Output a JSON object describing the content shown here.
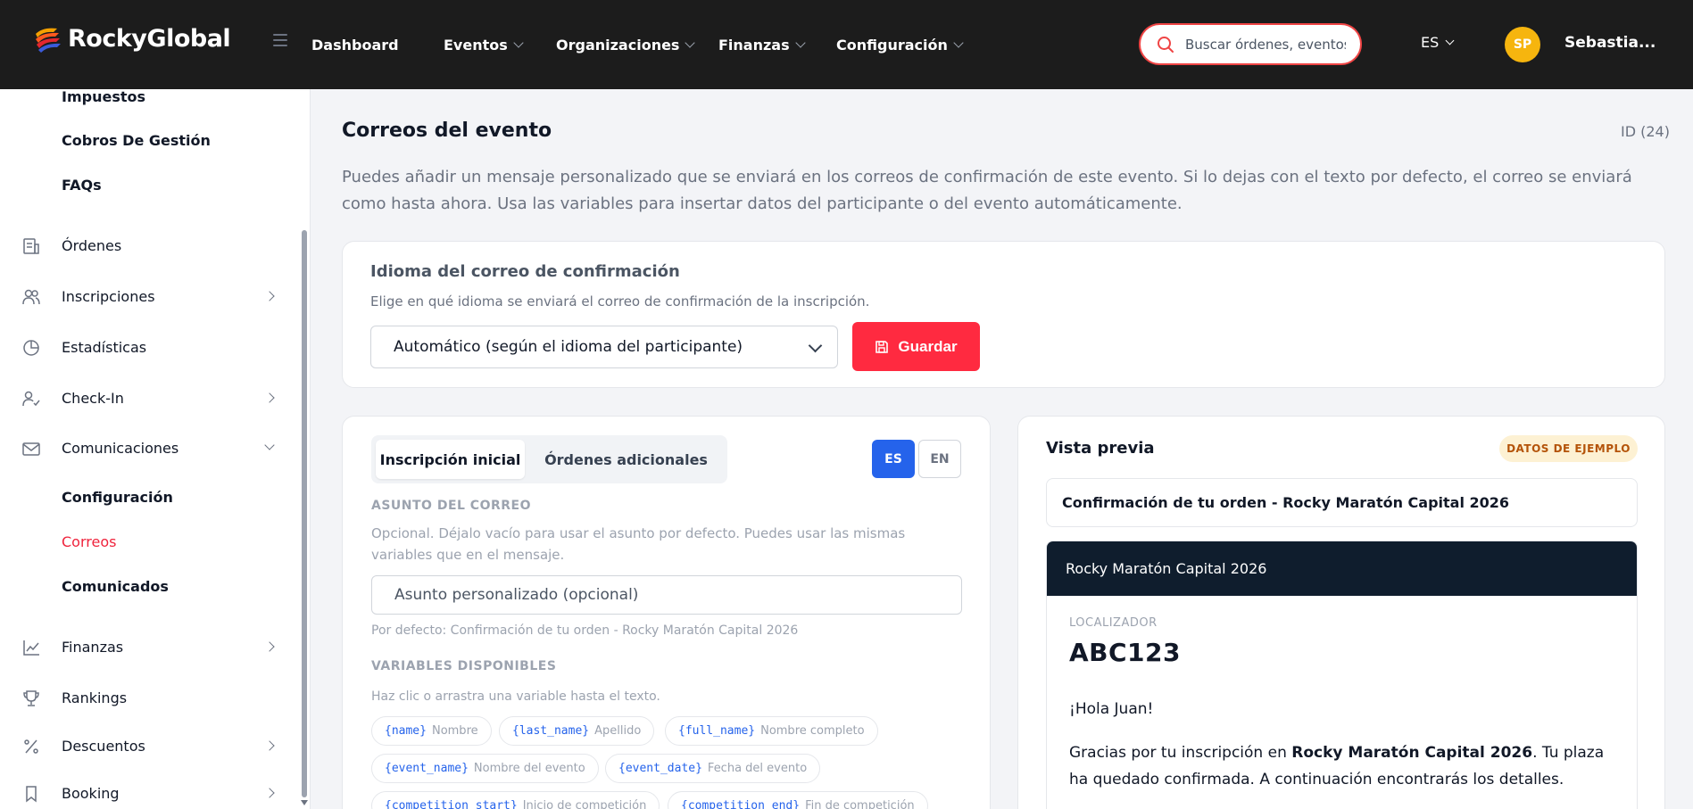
{
  "brand": {
    "name": "RockyGlobal"
  },
  "nav": [
    {
      "label": "Dashboard",
      "has_dropdown": false
    },
    {
      "label": "Eventos",
      "has_dropdown": true
    },
    {
      "label": "Organizaciones",
      "has_dropdown": true
    },
    {
      "label": "Finanzas",
      "has_dropdown": true
    },
    {
      "label": "Configuración",
      "has_dropdown": true
    }
  ],
  "search": {
    "placeholder": "Buscar órdenes, eventos"
  },
  "language": "ES",
  "user": {
    "initials": "SP",
    "name": "Sebastia..."
  },
  "sidebar": {
    "sub_top": [
      "Impuestos",
      "Cobros De Gestión",
      "FAQs"
    ],
    "items": [
      {
        "label": "Órdenes",
        "icon": "receipt-icon"
      },
      {
        "label": "Inscripciones",
        "icon": "users-icon"
      },
      {
        "label": "Estadísticas",
        "icon": "pie-chart-icon"
      },
      {
        "label": "Check-In",
        "icon": "user-check-icon"
      },
      {
        "label": "Comunicaciones",
        "icon": "mail-icon"
      }
    ],
    "comms_sub": [
      "Configuración",
      "Correos",
      "Comunicados"
    ],
    "items2": [
      {
        "label": "Finanzas",
        "icon": "trend-chart-icon"
      },
      {
        "label": "Rankings",
        "icon": "trophy-icon"
      },
      {
        "label": "Descuentos",
        "icon": "percent-icon"
      },
      {
        "label": "Booking",
        "icon": "bookmark-icon"
      }
    ]
  },
  "page": {
    "title": "Correos del evento",
    "id": "ID (24)",
    "description": "Puedes añadir un mensaje personalizado que se enviará en los correos de confirmación de este evento. Si lo dejas con el texto por defecto, el correo se enviará como hasta ahora. Usa las variables para insertar datos del participante o del evento automáticamente."
  },
  "language_card": {
    "title": "Idioma del correo de confirmación",
    "description": "Elige en qué idioma se enviará el correo de confirmación de la inscripción.",
    "selected": "Automático (según el idioma del participante)",
    "save_label": "Guardar"
  },
  "editor": {
    "tabs": [
      "Inscripción inicial",
      "Órdenes adicionales"
    ],
    "lang_buttons": [
      "ES",
      "EN"
    ],
    "subject_label": "ASUNTO DEL CORREO",
    "subject_help": "Opcional. Déjalo vacío para usar el asunto por defecto. Puedes usar las mismas variables que en el mensaje.",
    "subject_placeholder": "Asunto personalizado (opcional)",
    "subject_default": "Por defecto: Confirmación de tu orden - Rocky Maratón Capital 2026",
    "variables_label": "VARIABLES DISPONIBLES",
    "variables_help": "Haz clic o arrastra una variable hasta el texto.",
    "variables": [
      {
        "code": "{name}",
        "desc": "Nombre"
      },
      {
        "code": "{last_name}",
        "desc": "Apellido"
      },
      {
        "code": "{full_name}",
        "desc": "Nombre completo"
      },
      {
        "code": "{event_name}",
        "desc": "Nombre del evento"
      },
      {
        "code": "{event_date}",
        "desc": "Fecha del evento"
      },
      {
        "code": "{competition_start}",
        "desc": "Inicio de competición"
      },
      {
        "code": "{competition_end}",
        "desc": "Fin de competición"
      }
    ]
  },
  "preview": {
    "title": "Vista previa",
    "badge": "DATOS DE EJEMPLO",
    "subject": "Confirmación de tu orden - Rocky Maratón Capital 2026",
    "email_header": "Rocky Maratón Capital 2026",
    "locator_label": "LOCALIZADOR",
    "locator": "ABC123",
    "greeting": "¡Hola Juan!",
    "body_pre": "Gracias por tu inscripción en ",
    "body_event": "Rocky Maratón Capital 2026",
    "body_post": ". Tu plaza ha quedado confirmada. A continuación encontrarás los detalles."
  }
}
